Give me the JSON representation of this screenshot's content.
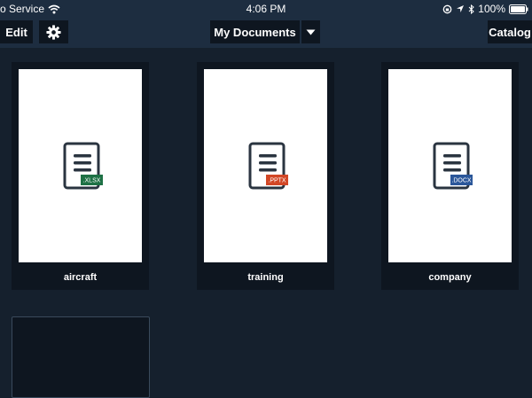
{
  "status_bar": {
    "carrier": "o Service",
    "time": "4:06 PM",
    "battery": "100%",
    "icons": [
      "wifi-icon",
      "rotation-lock-icon",
      "location-icon",
      "bluetooth-icon",
      "battery-icon"
    ]
  },
  "toolbar": {
    "edit_label": "Edit",
    "settings_icon": "gear-icon",
    "title": "My Documents",
    "dropdown_icon": "caret-down-icon",
    "catalog_label": "Catalog"
  },
  "documents": [
    {
      "name": "aircraft",
      "ext": ".XLSX",
      "color": "#1e7145"
    },
    {
      "name": "training",
      "ext": ".PPTX",
      "color": "#d24726"
    },
    {
      "name": "company",
      "ext": ".DOCX",
      "color": "#2b579a"
    }
  ],
  "colors": {
    "background": "#15202d",
    "bar": "#1d2d40",
    "button": "#0e1620"
  }
}
